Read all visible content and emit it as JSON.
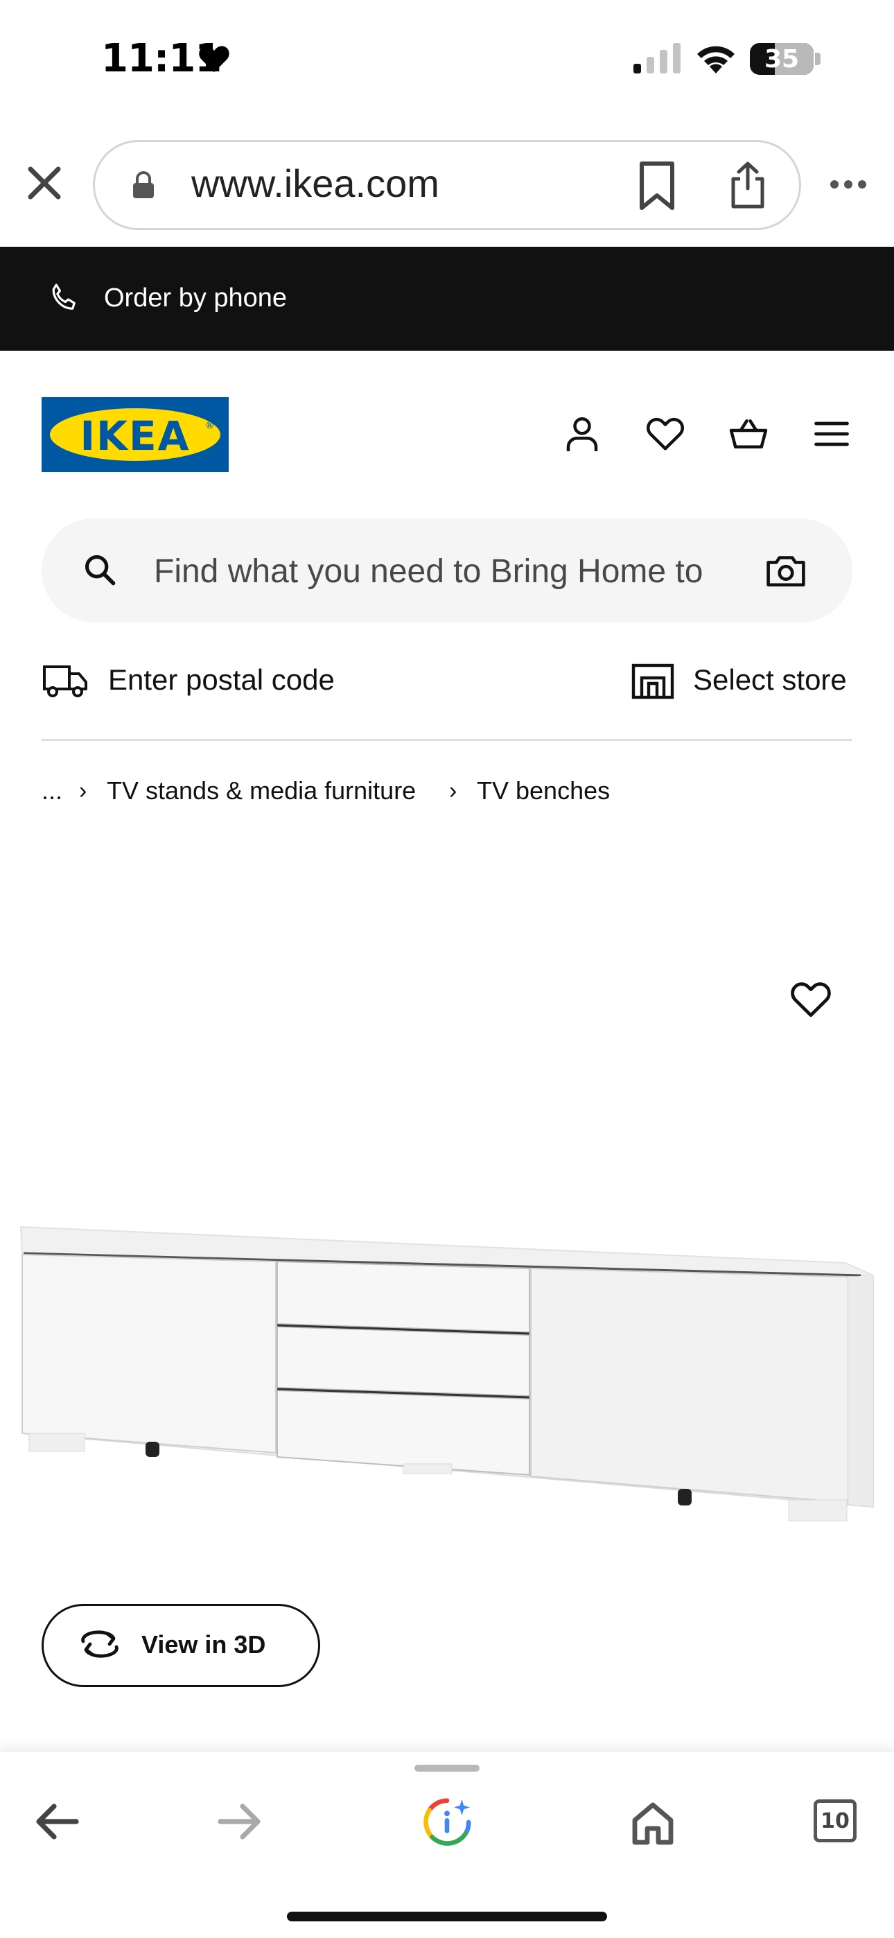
{
  "status_bar": {
    "time": "11:11",
    "battery": "35"
  },
  "browser": {
    "url": "www.ikea.com"
  },
  "banner": {
    "order_by_phone": "Order by phone"
  },
  "header": {
    "logo_text": "IKEA",
    "logo_reg": "®",
    "icons": [
      "profile-icon",
      "heart-icon",
      "basket-icon",
      "menu-icon"
    ]
  },
  "search": {
    "placeholder": "Find what you need to Bring Home to"
  },
  "delivery": {
    "postal_label": "Enter postal code",
    "store_label": "Select store"
  },
  "breadcrumb": {
    "ellipsis": "...",
    "items": [
      "TV stands & media furniture",
      "TV benches"
    ],
    "separator": "›"
  },
  "product": {
    "view_3d_label": "View in 3D"
  },
  "toolbar": {
    "tabs_count": "10"
  },
  "colors": {
    "ikea_blue": "#0058a3",
    "ikea_yellow": "#ffdb00",
    "banner_bg": "#111111"
  }
}
